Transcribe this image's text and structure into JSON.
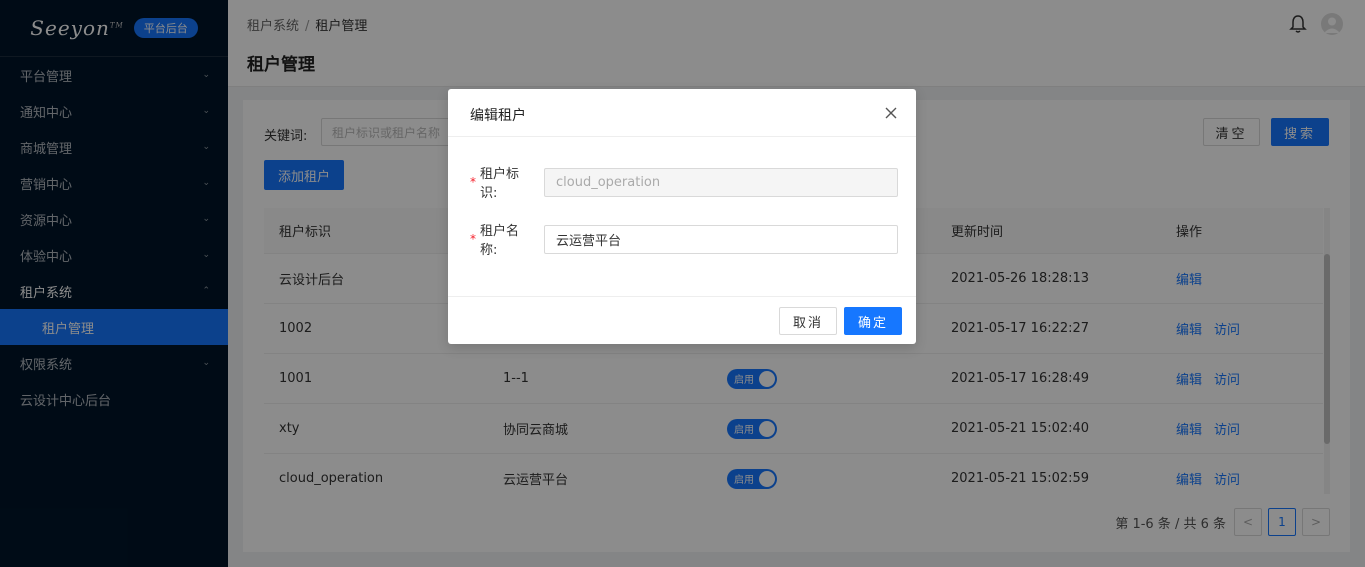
{
  "sidebar": {
    "logo": "Seeyon",
    "logo_tm": "TM",
    "badge": "平台后台",
    "items": [
      {
        "label": "平台管理"
      },
      {
        "label": "通知中心"
      },
      {
        "label": "商城管理"
      },
      {
        "label": "营销中心"
      },
      {
        "label": "资源中心"
      },
      {
        "label": "体验中心"
      },
      {
        "label": "租户系统"
      },
      {
        "label": "租户管理"
      },
      {
        "label": "权限系统"
      },
      {
        "label": "云设计中心后台"
      }
    ]
  },
  "header": {
    "breadcrumb": [
      "租户系统",
      "租户管理"
    ],
    "breadcrumb_sep": "/",
    "title": "租户管理"
  },
  "search": {
    "label": "关键词:",
    "placeholder": "租户标识或租户名称",
    "clear": "清空",
    "search": "搜索",
    "add": "添加租户"
  },
  "table": {
    "headers": [
      "租户标识",
      "更新时间",
      "操作"
    ],
    "rows": [
      {
        "id": "云设计后台",
        "name": "",
        "status": "",
        "updated": "2021-05-26 18:28:13",
        "edit": "编辑",
        "visit": ""
      },
      {
        "id": "1002",
        "name": "",
        "status": "",
        "updated": "2021-05-17 16:22:27",
        "edit": "编辑",
        "visit": "访问"
      },
      {
        "id": "1001",
        "name": "1--1",
        "status": "启用",
        "updated": "2021-05-17 16:28:49",
        "edit": "编辑",
        "visit": "访问"
      },
      {
        "id": "xty",
        "name": "协同云商城",
        "status": "启用",
        "updated": "2021-05-21 15:02:40",
        "edit": "编辑",
        "visit": "访问"
      },
      {
        "id": "cloud_operation",
        "name": "云运营平台",
        "status": "启用",
        "updated": "2021-05-21 15:02:59",
        "edit": "编辑",
        "visit": "访问"
      }
    ]
  },
  "pagination": {
    "info": "第 1-6 条 / 共 6 条",
    "current": "1",
    "prev": "<",
    "next": ">"
  },
  "modal": {
    "title": "编辑租户",
    "close": "×",
    "fields": [
      {
        "required": "*",
        "label": "租户标识:",
        "value": "cloud_operation"
      },
      {
        "required": "*",
        "label": "租户名称:",
        "value": "云运营平台"
      }
    ],
    "cancel": "取消",
    "ok": "确定"
  },
  "colors": {
    "primary": "#1677ff",
    "sidebar_bg": "#001529"
  }
}
